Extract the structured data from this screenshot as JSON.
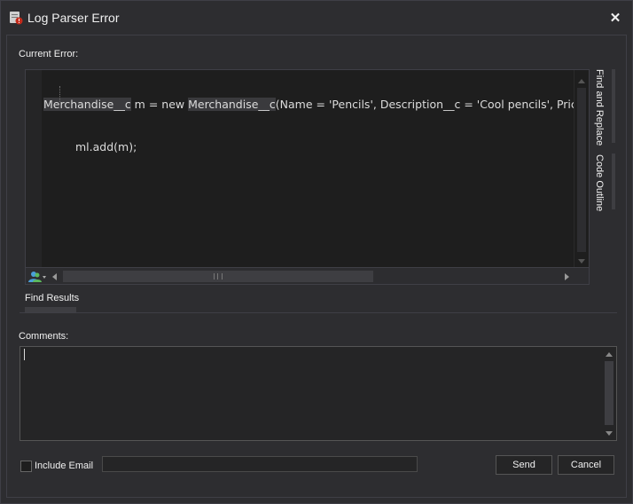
{
  "window": {
    "title": "Log Parser Error",
    "close_glyph": "✕"
  },
  "error_section": {
    "label": "Current Error:"
  },
  "code": {
    "line1": {
      "seg1": "Merchandise__c",
      "seg2": " m = new ",
      "seg3": "Merchandise__c",
      "seg4": "(Name = 'Pencils', Description__c = 'Cool pencils', Pric"
    },
    "line2": "ml.add(m);"
  },
  "side_tabs": {
    "find_replace": "Find and Replace",
    "code_outline": "Code Outline"
  },
  "find_results": {
    "label": "Find Results"
  },
  "comments": {
    "label": "Comments:",
    "value": ""
  },
  "include_email": {
    "label": "Include Email",
    "checked": false,
    "value": "",
    "placeholder": ""
  },
  "buttons": {
    "send": "Send",
    "cancel": "Cancel"
  },
  "icons": {
    "app": "app-error-icon",
    "user": "user-icon"
  },
  "colors": {
    "background": "#2d2d30",
    "editor": "#1e1e1e",
    "accent_red": "#c42b1c"
  }
}
